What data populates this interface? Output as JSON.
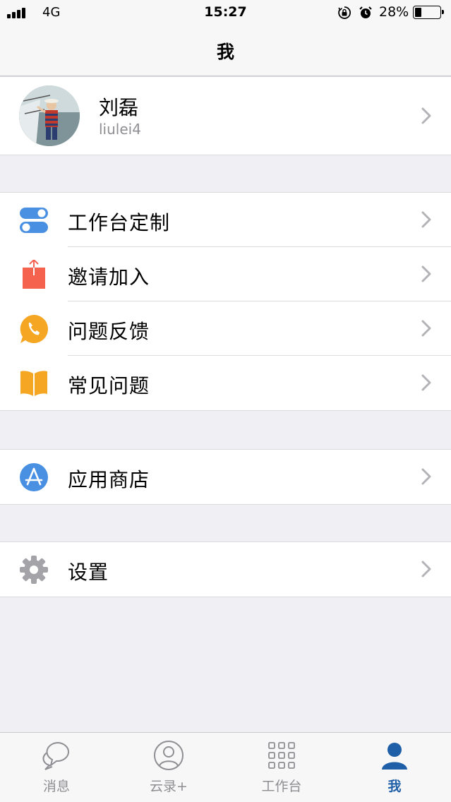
{
  "status_bar": {
    "carrier": "4G",
    "time": "15:27",
    "battery": "28%",
    "battery_level": 0.28
  },
  "header": {
    "title": "我"
  },
  "profile": {
    "name": "刘磊",
    "username": "liulei4"
  },
  "menu_groups": [
    {
      "items": [
        {
          "label": "工作台定制",
          "icon": "toggle-icon",
          "color": "#4a90e2"
        },
        {
          "label": "邀请加入",
          "icon": "share-icon",
          "color": "#f5624e"
        },
        {
          "label": "问题反馈",
          "icon": "phone-chat-icon",
          "color": "#f5a623"
        },
        {
          "label": "常见问题",
          "icon": "book-icon",
          "color": "#f5a623"
        }
      ]
    },
    {
      "items": [
        {
          "label": "应用商店",
          "icon": "app-store-icon",
          "color": "#4a90e2"
        }
      ]
    },
    {
      "items": [
        {
          "label": "设置",
          "icon": "gear-icon",
          "color": "#8e8e93"
        }
      ]
    }
  ],
  "tabs": [
    {
      "label": "消息",
      "icon": "chat-bubble-icon",
      "active": false
    },
    {
      "label": "云录+",
      "icon": "contact-icon",
      "active": false
    },
    {
      "label": "工作台",
      "icon": "grid-icon",
      "active": false
    },
    {
      "label": "我",
      "icon": "person-icon",
      "active": true
    }
  ],
  "colors": {
    "accent": "#1f5fa8",
    "inactive": "#8e8e93",
    "background": "#efeff4"
  }
}
